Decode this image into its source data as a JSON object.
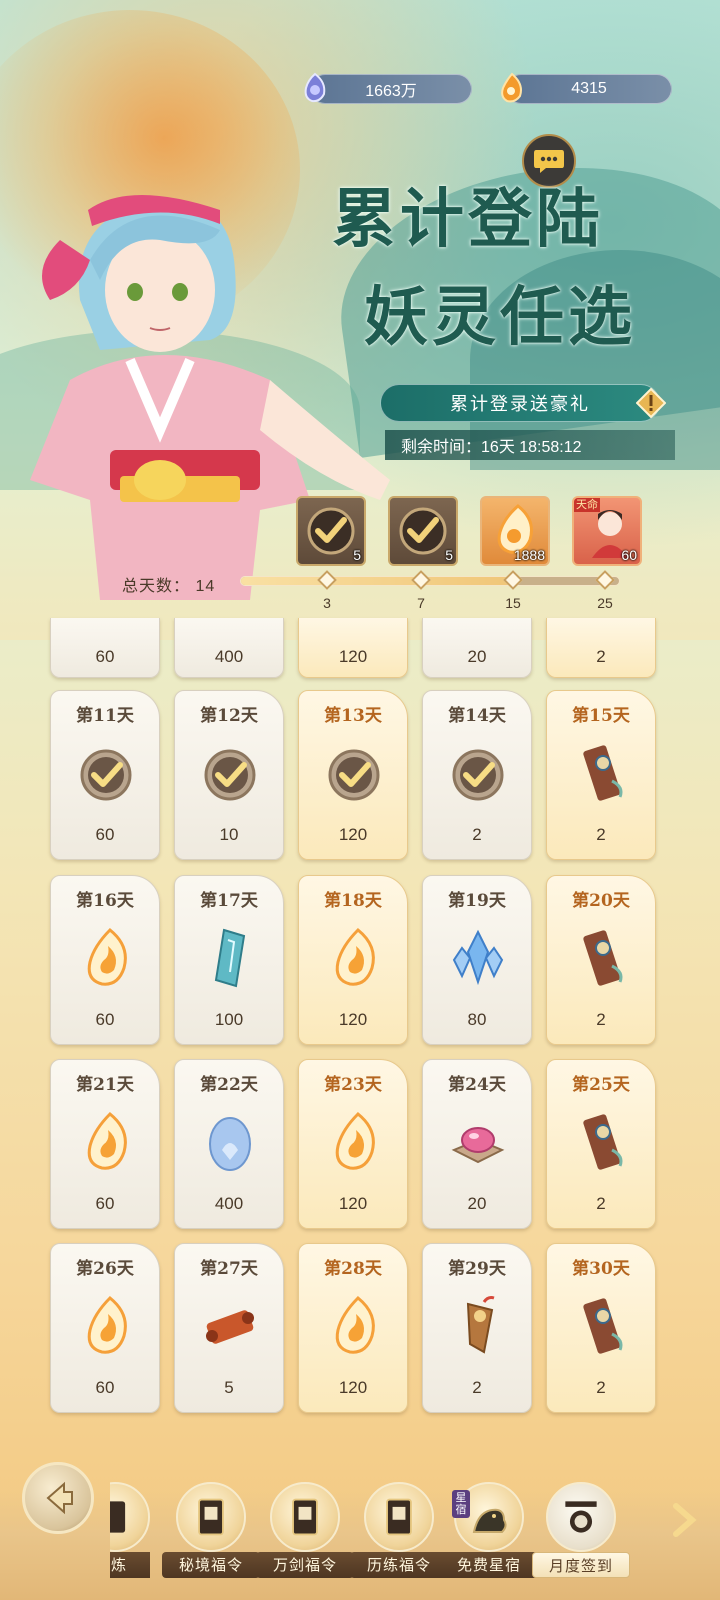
{
  "currency": {
    "coins": "1663万",
    "spirit": "4315"
  },
  "title": {
    "line1": "累计登陆",
    "line2": "妖灵任选"
  },
  "subtitle": "累计登录送豪礼",
  "remaining": {
    "label": "剩余时间：",
    "value": "16天 18:58:12"
  },
  "milestone_rewards": [
    {
      "icon": "check-token-icon",
      "count": "5"
    },
    {
      "icon": "check-token-icon",
      "count": "5"
    },
    {
      "icon": "spirit-flame-icon",
      "count": "1888"
    },
    {
      "icon": "character-card-icon",
      "tag": "天命",
      "count": "60"
    }
  ],
  "progress": {
    "label": "总天数：",
    "total_days": "14",
    "milestones": [
      "3",
      "7",
      "15",
      "25"
    ],
    "fraction": 0.72
  },
  "partial_row": [
    {
      "value": "60",
      "gold": false
    },
    {
      "value": "400",
      "gold": false
    },
    {
      "value": "120",
      "gold": true
    },
    {
      "value": "20",
      "gold": false
    },
    {
      "value": "2",
      "gold": true
    }
  ],
  "days": [
    {
      "day": "第11天",
      "value": "60",
      "gold": false,
      "icon": "check-token-icon"
    },
    {
      "day": "第12天",
      "value": "10",
      "gold": false,
      "icon": "check-token-icon"
    },
    {
      "day": "第13天",
      "value": "120",
      "gold": true,
      "icon": "check-token-icon"
    },
    {
      "day": "第14天",
      "value": "2",
      "gold": false,
      "icon": "check-token-icon"
    },
    {
      "day": "第15天",
      "value": "2",
      "gold": true,
      "icon": "talisman-icon"
    },
    {
      "day": "第16天",
      "value": "60",
      "gold": false,
      "icon": "spirit-flame-icon"
    },
    {
      "day": "第17天",
      "value": "100",
      "gold": false,
      "icon": "jade-shard-icon"
    },
    {
      "day": "第18天",
      "value": "120",
      "gold": true,
      "icon": "spirit-flame-icon"
    },
    {
      "day": "第19天",
      "value": "80",
      "gold": false,
      "icon": "ice-crystal-icon"
    },
    {
      "day": "第20天",
      "value": "2",
      "gold": true,
      "icon": "talisman-icon"
    },
    {
      "day": "第21天",
      "value": "60",
      "gold": false,
      "icon": "spirit-flame-icon"
    },
    {
      "day": "第22天",
      "value": "400",
      "gold": false,
      "icon": "spirit-egg-icon"
    },
    {
      "day": "第23天",
      "value": "120",
      "gold": true,
      "icon": "spirit-flame-icon"
    },
    {
      "day": "第24天",
      "value": "20",
      "gold": false,
      "icon": "pink-gem-icon"
    },
    {
      "day": "第25天",
      "value": "2",
      "gold": true,
      "icon": "talisman-icon"
    },
    {
      "day": "第26天",
      "value": "60",
      "gold": false,
      "icon": "spirit-flame-icon"
    },
    {
      "day": "第27天",
      "value": "5",
      "gold": false,
      "icon": "scroll-icon"
    },
    {
      "day": "第28天",
      "value": "120",
      "gold": true,
      "icon": "spirit-flame-icon"
    },
    {
      "day": "第29天",
      "value": "2",
      "gold": false,
      "icon": "bronze-token-icon"
    },
    {
      "day": "第30天",
      "value": "2",
      "gold": true,
      "icon": "talisman-icon"
    }
  ],
  "tabs": [
    {
      "label": "历炼",
      "icon": "training-icon"
    },
    {
      "label": "秘境福令",
      "icon": "fortune-tag-icon"
    },
    {
      "label": "万剑福令",
      "icon": "fortune-tag-icon"
    },
    {
      "label": "历练福令",
      "icon": "fortune-tag-icon"
    },
    {
      "label": "免费星宿",
      "icon": "star-beast-icon",
      "badge": "星宿"
    },
    {
      "label": "月度签到",
      "icon": "sign-in-icon",
      "active": true
    }
  ],
  "colors": {
    "gold_day": "#b4651f",
    "normal_day": "#5a4a3a",
    "title": "#1f5b50",
    "accent_teal": "#1c6e68"
  }
}
